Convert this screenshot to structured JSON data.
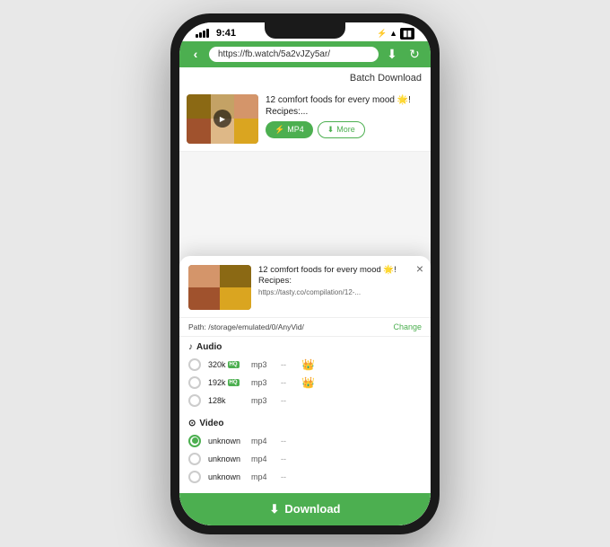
{
  "status_bar": {
    "time": "9:41",
    "dots": [
      "•",
      "•",
      "•"
    ],
    "bluetooth": "B",
    "battery": "▮"
  },
  "url_bar": {
    "url": "https://fb.watch/5a2vJZy5ar/"
  },
  "browser": {
    "batch_download_label": "Batch Download",
    "video_card": {
      "title": "12 comfort foods for every mood 🌟! Recipes:...",
      "btn_mp4": "MP4",
      "btn_more": "More"
    }
  },
  "bottom_sheet": {
    "title": "12 comfort foods for every mood 🌟! Recipes:",
    "url": "https://tasty.co/compilation/12-...",
    "path": "Path: /storage/emulated/0/AnyVid/",
    "change_label": "Change",
    "close_label": "×",
    "audio_section": "Audio",
    "video_section": "Video",
    "formats": {
      "audio": [
        {
          "quality": "320k",
          "hq": true,
          "type": "mp3",
          "size": "--",
          "premium": true
        },
        {
          "quality": "192k",
          "hq": true,
          "type": "mp3",
          "size": "--",
          "premium": true
        },
        {
          "quality": "128k",
          "hq": false,
          "type": "mp3",
          "size": "--",
          "premium": false
        }
      ],
      "video": [
        {
          "quality": "unknown",
          "hq": false,
          "type": "mp4",
          "size": "--",
          "selected": true,
          "premium": false
        },
        {
          "quality": "unknown",
          "hq": false,
          "type": "mp4",
          "size": "--",
          "selected": false,
          "premium": false
        },
        {
          "quality": "unknown",
          "hq": false,
          "type": "mp4",
          "size": "--",
          "selected": false,
          "premium": false
        }
      ]
    },
    "download_btn": "Download"
  }
}
